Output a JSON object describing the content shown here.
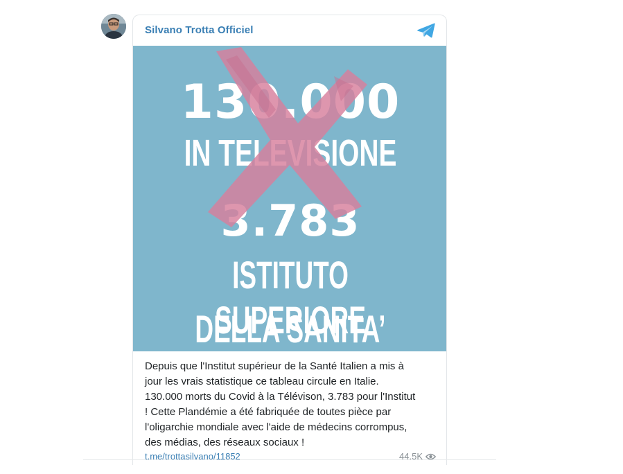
{
  "channel": {
    "name": "Silvano Trotta Officiel",
    "avatar_icon": "person-photo-avatar",
    "platform_icon": "telegram-paper-plane-icon"
  },
  "image": {
    "line1": "130.000",
    "line2": "IN TELEVISIONE",
    "line3": "3.783",
    "line4": "ISTITUTO SUPERIORE",
    "line5": "DELLA SANITA’",
    "background_color": "#7fb6cc",
    "cross_color": "#d77f9c"
  },
  "caption": {
    "lines": [
      "Depuis que l'Institut supérieur de la Santé Italien a mis à",
      "jour les vrais statistique ce tableau circule en Italie.",
      "130.000 morts du Covid à la Télévison, 3.783 pour l'Institut",
      "! Cette Plandémie a été fabriquée de toutes pièce par",
      "l'oligarchie mondiale avec l'aide de médecins corrompus,",
      "des médias, des réseaux sociaux !"
    ]
  },
  "footer": {
    "link": "t.me/trottasilvano/11852",
    "views": "44.5K",
    "views_icon": "eye-icon"
  },
  "colors": {
    "link": "#3a7fb4",
    "muted": "#8a9196",
    "text": "#1f2326"
  }
}
